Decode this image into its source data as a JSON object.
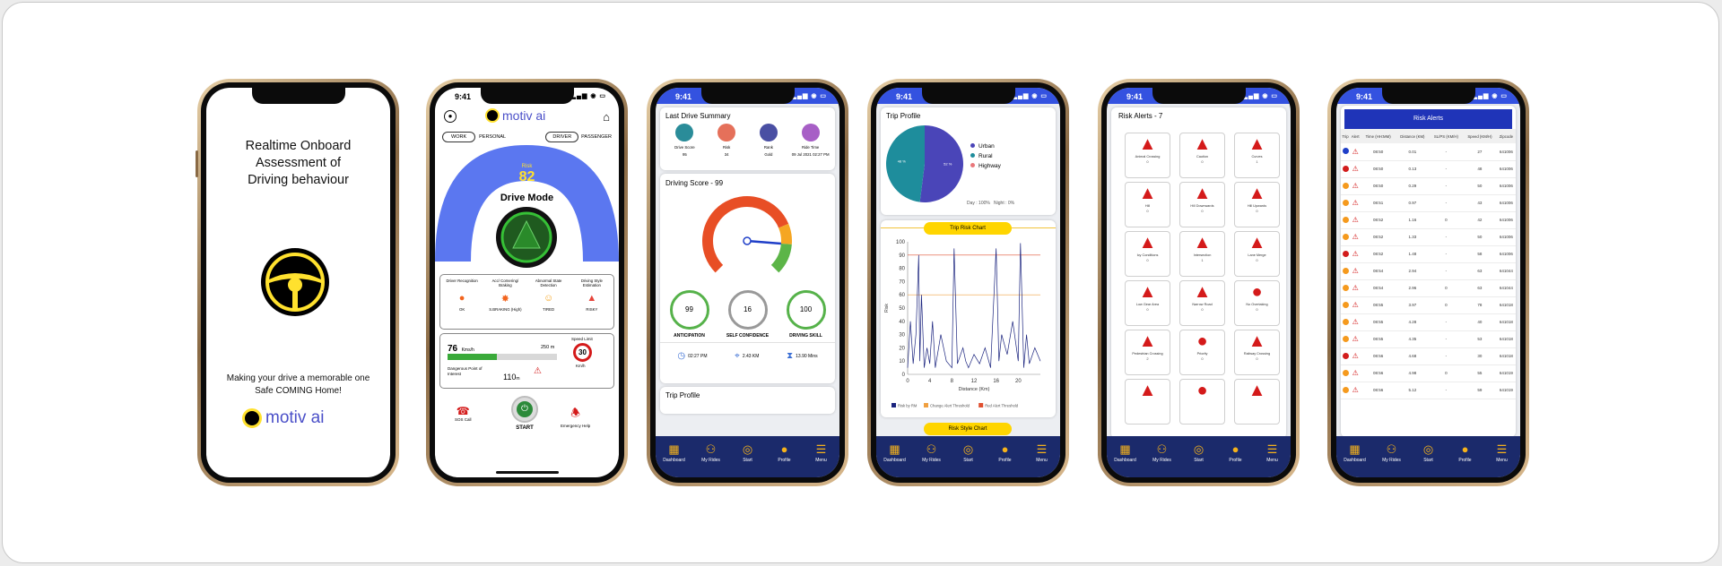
{
  "status_time": "9:41",
  "screen1": {
    "title_lines": [
      "Realtime Onboard",
      "Assessment of",
      "Driving behaviour"
    ],
    "tagline": [
      "Making your drive a memorable one",
      "Safe COMING Home!"
    ],
    "brand": "motiv ai"
  },
  "screen2": {
    "brand": "motiv ai",
    "toggle1": [
      "WORK",
      "PERSONAL"
    ],
    "toggle2": [
      "DRIVER",
      "PASSENGER"
    ],
    "risk_label": "Risk",
    "risk_value": "82",
    "mode": "Drive Mode",
    "features": [
      {
        "label": "Driver Recognition",
        "status": "OK"
      },
      {
        "label": "Acc/ Cornering/ Braking",
        "status": "S.BRAKING (High)"
      },
      {
        "label": "Abnormal State Detection",
        "status": "TIRED"
      },
      {
        "label": "Driving Style Estimation",
        "status": "RISKY"
      }
    ],
    "speed": "76",
    "speed_unit": "Kms/h",
    "distance": "250 m",
    "progress": 0.45,
    "dangerous": "Dangerous Point of Interest",
    "poi_dist": "110",
    "poi_unit": "m",
    "speed_limit_label": "Speed Limit",
    "speed_limit": "30",
    "speed_limit_unit": "Km/h",
    "sos": "SOS Call",
    "start": "START",
    "emergency": "Emergency Help"
  },
  "screen3": {
    "summary_title": "Last Drive Summary",
    "summary": [
      {
        "label": "Drive Score",
        "value": "95",
        "color": "#2a8c99"
      },
      {
        "label": "Risk",
        "value": "34",
        "color": "#e5705a"
      },
      {
        "label": "Rank",
        "value": "Gold",
        "color": "#4a4fa3"
      },
      {
        "label": "Ride Time",
        "value": "09 Jul 2021 02:27 PM",
        "color": "#a75fc6"
      }
    ],
    "score_title": "Driving Score - 99",
    "gauge_value": 0.85,
    "circles": [
      {
        "value": "99",
        "label": "ANTICIPATION",
        "color": "#56b24a"
      },
      {
        "value": "16",
        "label": "SELF CONFIDENCE",
        "color": "#999999"
      },
      {
        "value": "100",
        "label": "DRIVING SKILL",
        "color": "#56b24a"
      }
    ],
    "trip": [
      {
        "icon": "clock-icon",
        "text": "02:27 PM"
      },
      {
        "icon": "pin-icon",
        "text": "2.43 KM"
      },
      {
        "icon": "hourglass-icon",
        "text": "13.90 Mins"
      }
    ],
    "trip_profile": "Trip Profile"
  },
  "screen4": {
    "title": "Trip Profile",
    "pie": [
      {
        "name": "Urban",
        "value": 52,
        "color": "#4a45b8"
      },
      {
        "name": "Rural",
        "value": 48,
        "color": "#1e8d9c"
      },
      {
        "name": "Highway",
        "value": 0,
        "color": "#e9777b"
      }
    ],
    "day": "Day : 100%",
    "night": "Night : 0%",
    "chart_button": "Trip Risk Chart",
    "style_button": "Risk Style Chart"
  },
  "chart_data": {
    "type": "line",
    "ylabel": "Risk",
    "xlabel": "Distance (Km)",
    "xlim": [
      0,
      24
    ],
    "ylim": [
      0,
      100
    ],
    "x_ticks": [
      0,
      4,
      8,
      12,
      16,
      20
    ],
    "y_ticks": [
      0,
      10,
      20,
      30,
      40,
      50,
      60,
      70,
      80,
      90,
      100
    ],
    "series": [
      {
        "name": "Risk by RM",
        "color": "#1a237e",
        "x": [
          0,
          0.5,
          1,
          1.5,
          2,
          2.2,
          2.5,
          3,
          3.5,
          4,
          4.5,
          5,
          6,
          7,
          8,
          8.4,
          9,
          10,
          10.5,
          11,
          12,
          13,
          14,
          15,
          16,
          16.5,
          17,
          18,
          19,
          20,
          20.4,
          21,
          21.5,
          22,
          23,
          24
        ],
        "y": [
          5,
          40,
          8,
          30,
          90,
          10,
          60,
          5,
          20,
          8,
          40,
          5,
          30,
          10,
          5,
          95,
          8,
          20,
          10,
          5,
          15,
          8,
          20,
          5,
          95,
          10,
          30,
          15,
          40,
          10,
          99,
          5,
          30,
          8,
          20,
          10
        ]
      }
    ],
    "thresholds": [
      {
        "name": "Change Alert Threshold",
        "y": 60,
        "color": "#f0a040"
      },
      {
        "name": "Red Alert Threshold",
        "y": 90,
        "color": "#e05030"
      }
    ]
  },
  "screen5": {
    "title": "Risk Alerts - 7",
    "signs": [
      {
        "name": "Animal Crossing",
        "count": "0"
      },
      {
        "name": "Caution",
        "count": "0"
      },
      {
        "name": "Curves",
        "count": "1"
      },
      {
        "name": "Hill",
        "count": "0"
      },
      {
        "name": "Hill Downwards",
        "count": "0"
      },
      {
        "name": "Hill Upwards",
        "count": "0"
      },
      {
        "name": "Icy Conditions",
        "count": "0"
      },
      {
        "name": "Intersection",
        "count": "1"
      },
      {
        "name": "Lane Merge",
        "count": "0"
      },
      {
        "name": "Low Gear Area",
        "count": "0"
      },
      {
        "name": "Narrow Road",
        "count": "0"
      },
      {
        "name": "No Overtaking",
        "count": "0"
      },
      {
        "name": "Pedestrian Crossing",
        "count": "2"
      },
      {
        "name": "Priority",
        "count": "0"
      },
      {
        "name": "Railway Crossing",
        "count": "0"
      },
      {
        "name": "",
        "count": ""
      },
      {
        "name": "",
        "count": ""
      },
      {
        "name": "",
        "count": ""
      }
    ]
  },
  "screen6": {
    "header": "Risk Alerts",
    "columns": [
      "Trip",
      "Alert",
      "Time (HH:MM)",
      "Distance (KM)",
      "SL/PS (KM/H)",
      "Speed (KM/H)",
      "Zipcode"
    ],
    "rows": [
      [
        "#1f3fc8",
        "08:50",
        "0.01",
        "-",
        "27",
        "641006"
      ],
      [
        "#d21c1c",
        "08:50",
        "0.13",
        "-",
        "48",
        "641006"
      ],
      [
        "#f59a1e",
        "08:50",
        "0.29",
        "-",
        "50",
        "641006"
      ],
      [
        "#f59a1e",
        "08:51",
        "0.97",
        "-",
        "43",
        "641006"
      ],
      [
        "#f59a1e",
        "08:52",
        "1.16",
        "0",
        "42",
        "641006"
      ],
      [
        "#f59a1e",
        "08:52",
        "1.33",
        "-",
        "50",
        "641006"
      ],
      [
        "#d21c1c",
        "08:52",
        "1.48",
        "-",
        "58",
        "641006"
      ],
      [
        "#f59a1e",
        "08:54",
        "2.94",
        "-",
        "63",
        "641044"
      ],
      [
        "#f59a1e",
        "08:54",
        "2.96",
        "0",
        "63",
        "641044"
      ],
      [
        "#f59a1e",
        "08:55",
        "3.97",
        "0",
        "78",
        "641018"
      ],
      [
        "#f59a1e",
        "08:55",
        "4.28",
        "-",
        "40",
        "641018"
      ],
      [
        "#f59a1e",
        "08:55",
        "4.35",
        "-",
        "53",
        "641018"
      ],
      [
        "#d21c1c",
        "08:56",
        "4.68",
        "-",
        "30",
        "641018"
      ],
      [
        "#f59a1e",
        "08:56",
        "4.98",
        "0",
        "55",
        "641019"
      ],
      [
        "#f59a1e",
        "08:56",
        "5.12",
        "-",
        "59",
        "641019"
      ]
    ]
  },
  "tabs": [
    "Dashboard",
    "My Rides",
    "Start",
    "Profile",
    "Menu"
  ]
}
